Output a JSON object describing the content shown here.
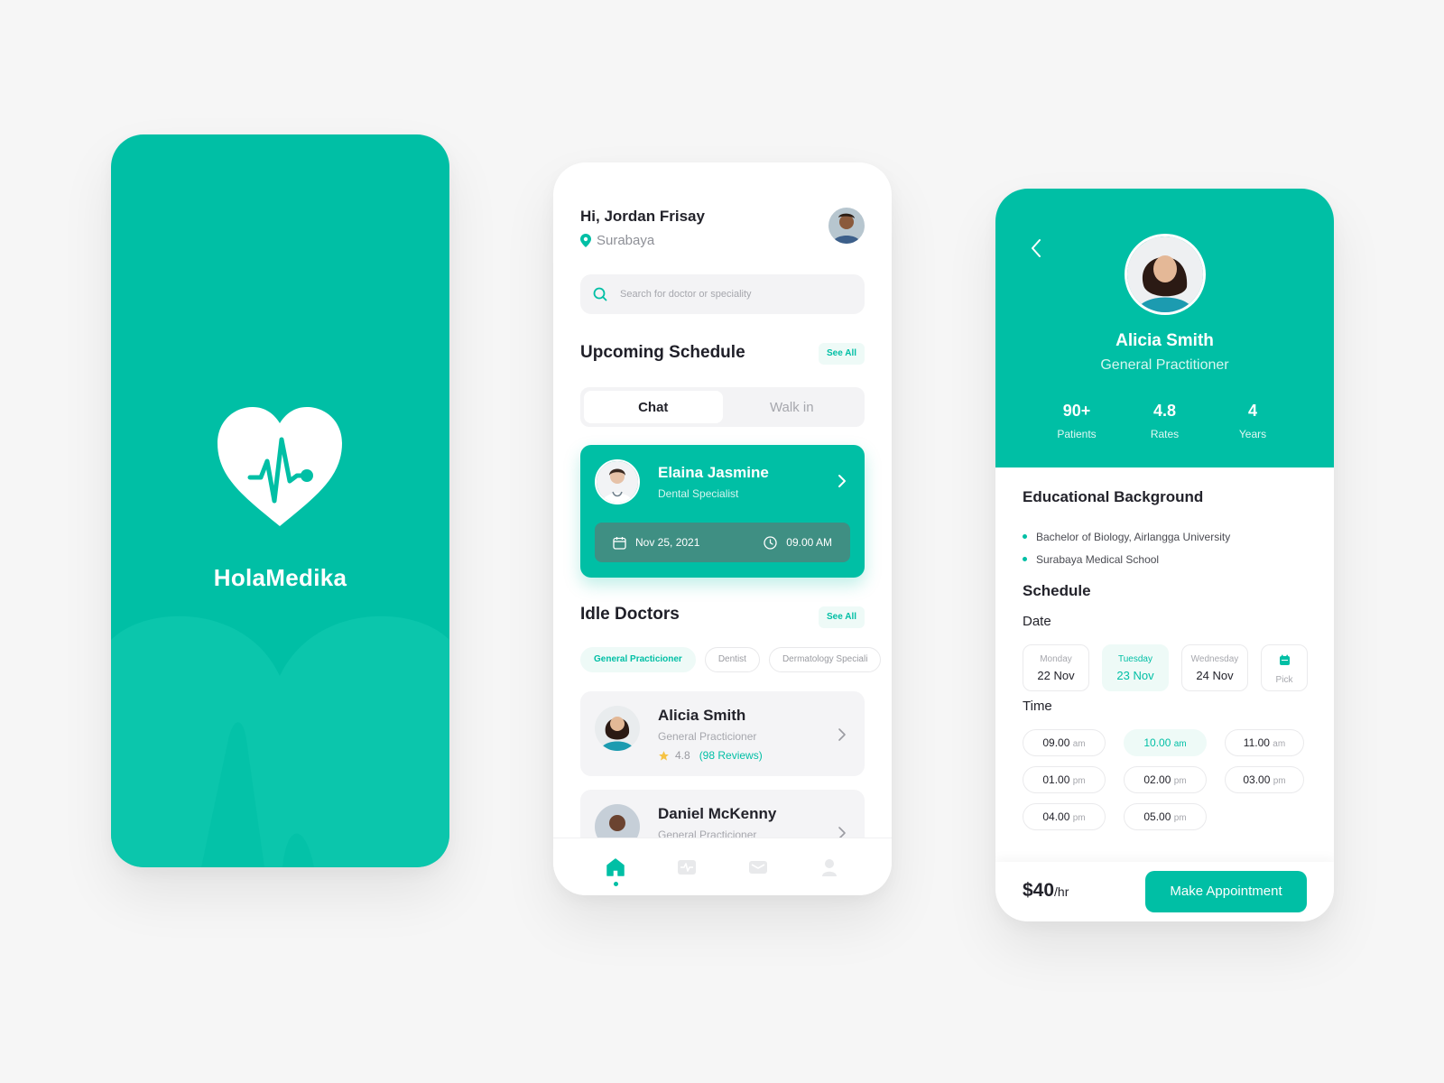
{
  "splash": {
    "brand": "HolaMedika",
    "brand_color": "#00bfa5"
  },
  "home": {
    "greeting": "Hi, Jordan Frisay",
    "location": "Surabaya",
    "search_placeholder": "Search for doctor or speciality",
    "upcoming_title": "Upcoming Schedule",
    "see_all": "See All",
    "tabs": [
      {
        "label": "Chat",
        "active": true
      },
      {
        "label": "Walk in",
        "active": false
      }
    ],
    "appointment": {
      "name": "Elaina Jasmine",
      "specialty": "Dental Specialist",
      "date": "Nov 25, 2021",
      "time": "09.00 AM"
    },
    "idle_title": "Idle Doctors",
    "filters": [
      {
        "label": "General Practicioner",
        "active": true
      },
      {
        "label": "Dentist",
        "active": false
      },
      {
        "label": "Dermatology Speciali",
        "active": false
      }
    ],
    "doctors": [
      {
        "name": "Alicia Smith",
        "specialty": "General Practicioner",
        "rating": "4.8",
        "reviews": "(98 Reviews)"
      },
      {
        "name": "Daniel McKenny",
        "specialty": "General Practicioner"
      }
    ],
    "nav": [
      "home-icon",
      "heartbeat-icon",
      "mail-icon",
      "user-icon"
    ]
  },
  "detail": {
    "name": "Alicia Smith",
    "specialty": "General Practitioner",
    "stats": [
      {
        "value": "90+",
        "label": "Patients"
      },
      {
        "value": "4.8",
        "label": "Rates"
      },
      {
        "value": "4",
        "label": "Years"
      }
    ],
    "edu_title": "Educational Background",
    "education": [
      "Bachelor of Biology, Airlangga University",
      "Surabaya Medical School"
    ],
    "schedule_title": "Schedule",
    "date_label": "Date",
    "dates": [
      {
        "weekday": "Monday",
        "day": "22 Nov",
        "active": false
      },
      {
        "weekday": "Tuesday",
        "day": "23 Nov",
        "active": true
      },
      {
        "weekday": "Wednesday",
        "day": "24 Nov",
        "active": false
      }
    ],
    "pick_label": "Pick",
    "time_label": "Time",
    "times": [
      {
        "time": "09.00",
        "ap": "am",
        "active": false
      },
      {
        "time": "10.00",
        "ap": "am",
        "active": true
      },
      {
        "time": "11.00",
        "ap": "am",
        "active": false
      },
      {
        "time": "01.00",
        "ap": "pm",
        "active": false
      },
      {
        "time": "02.00",
        "ap": "pm",
        "active": false
      },
      {
        "time": "03.00",
        "ap": "pm",
        "active": false
      },
      {
        "time": "04.00",
        "ap": "pm",
        "active": false
      },
      {
        "time": "05.00",
        "ap": "pm",
        "active": false
      }
    ],
    "price": "$40",
    "price_unit": "/hr",
    "cta": "Make Appointment"
  }
}
